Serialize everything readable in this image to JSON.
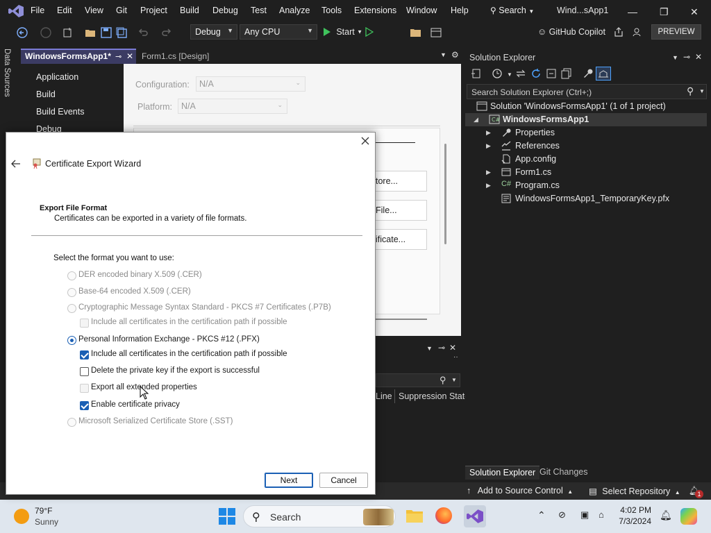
{
  "menubar": {
    "items": [
      "File",
      "Edit",
      "View",
      "Git",
      "Project",
      "Build",
      "Debug",
      "Test",
      "Analyze",
      "Tools",
      "Extensions",
      "Window",
      "Help"
    ],
    "search_label": "Search",
    "window_title": "Wind...sApp1"
  },
  "toolbar": {
    "config": "Debug",
    "platform": "Any CPU",
    "start_label": "Start",
    "copilot_label": "GitHub Copilot",
    "preview_label": "PREVIEW"
  },
  "side_tab": {
    "label": "Data Sources"
  },
  "doc_tabs": [
    {
      "label": "WindowsFormsApp1*"
    },
    {
      "label": "Form1.cs [Design]"
    }
  ],
  "project_properties": {
    "nav": [
      "Application",
      "Build",
      "Build Events",
      "Debug"
    ],
    "configuration_label": "Configuration:",
    "configuration_value": "N/A",
    "platform_label": "Platform:",
    "platform_value": "N/A",
    "buttons": [
      "tore...",
      "File...",
      "ificate..."
    ]
  },
  "error_list": {
    "columns": [
      "Line",
      "Suppression State"
    ]
  },
  "solution_explorer": {
    "title": "Solution Explorer",
    "search_placeholder": "Search Solution Explorer (Ctrl+;)",
    "solution_label": "Solution 'WindowsFormsApp1' (1 of 1 project)",
    "project_label": "WindowsFormsApp1",
    "items": [
      {
        "label": "Properties",
        "icon": "wrench-icon",
        "expandable": true
      },
      {
        "label": "References",
        "icon": "references-icon",
        "expandable": true
      },
      {
        "label": "App.config",
        "icon": "config-file-icon",
        "expandable": false
      },
      {
        "label": "Form1.cs",
        "icon": "form-icon",
        "expandable": true
      },
      {
        "label": "Program.cs",
        "icon": "csharp-file-icon",
        "expandable": true
      },
      {
        "label": "WindowsFormsApp1_TemporaryKey.pfx",
        "icon": "certificate-file-icon",
        "expandable": false
      }
    ],
    "bottom_tabs": [
      "Solution Explorer",
      "Git Changes"
    ]
  },
  "status_bar": {
    "add_source_control": "Add to Source Control",
    "select_repository": "Select Repository",
    "notification_count": "1"
  },
  "taskbar": {
    "temperature": "79°F",
    "condition": "Sunny",
    "search_label": "Search",
    "time": "4:02 PM",
    "date": "7/3/2024"
  },
  "dialog": {
    "title": "Certificate Export Wizard",
    "section_heading": "Export File Format",
    "section_description": "Certificates can be exported in a variety of file formats.",
    "prompt": "Select the format you want to use:",
    "options": [
      {
        "label": "DER encoded binary X.509 (.CER)",
        "kind": "radio",
        "checked": false,
        "enabled": false
      },
      {
        "label": "Base-64 encoded X.509 (.CER)",
        "kind": "radio",
        "checked": false,
        "enabled": false
      },
      {
        "label": "Cryptographic Message Syntax Standard - PKCS #7 Certificates (.P7B)",
        "kind": "radio",
        "checked": false,
        "enabled": false
      },
      {
        "label": "Include all certificates in the certification path if possible",
        "kind": "checkbox",
        "checked": false,
        "enabled": false
      },
      {
        "label": "Personal Information Exchange - PKCS #12 (.PFX)",
        "kind": "radio",
        "checked": true,
        "enabled": true
      },
      {
        "label": "Include all certificates in the certification path if possible",
        "kind": "checkbox",
        "checked": true,
        "enabled": true
      },
      {
        "label": "Delete the private key if the export is successful",
        "kind": "checkbox",
        "checked": false,
        "enabled": true
      },
      {
        "label": "Export all extended properties",
        "kind": "checkbox",
        "checked": false,
        "enabled": false
      },
      {
        "label": "Enable certificate privacy",
        "kind": "checkbox",
        "checked": true,
        "enabled": true
      },
      {
        "label": "Microsoft Serialized Certificate Store (.SST)",
        "kind": "radio",
        "checked": false,
        "enabled": false
      }
    ],
    "next_label": "Next",
    "cancel_label": "Cancel"
  },
  "colors": {
    "accent": "#1a5fb4",
    "vs_purple": "#7b7bd6",
    "ide_background": "#1f1f1f"
  }
}
